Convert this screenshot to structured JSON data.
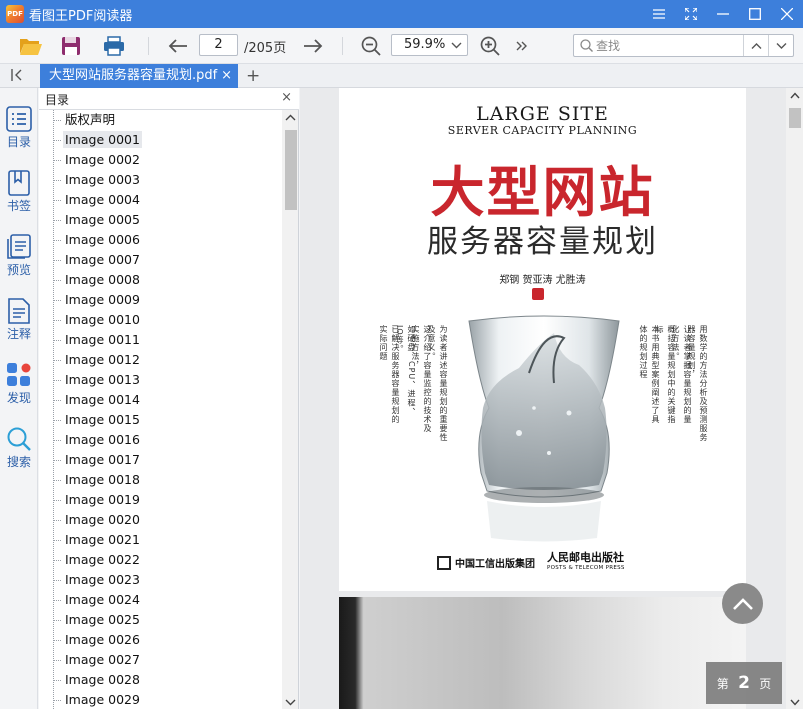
{
  "window": {
    "app_title": "看图王PDF阅读器",
    "logo_text": "PDF"
  },
  "toolbar": {
    "current_page": "2",
    "total_pages": "/205页",
    "zoom": "59.9%",
    "search_placeholder": "查找"
  },
  "tab": {
    "label": "大型网站服务器容量规划.pdf",
    "close": "×",
    "add": "+"
  },
  "rail": [
    {
      "label": "目录",
      "icon": "toc-icon"
    },
    {
      "label": "书签",
      "icon": "bookmark-icon"
    },
    {
      "label": "预览",
      "icon": "preview-icon"
    },
    {
      "label": "注释",
      "icon": "annotation-icon"
    },
    {
      "label": "发现",
      "icon": "discover-icon"
    },
    {
      "label": "搜索",
      "icon": "search-icon"
    }
  ],
  "outline": {
    "title": "目录",
    "close": "×",
    "items": [
      "版权声明",
      "Image 0001",
      "Image 0002",
      "Image 0003",
      "Image 0004",
      "Image 0005",
      "Image 0006",
      "Image 0007",
      "Image 0008",
      "Image 0009",
      "Image 0010",
      "Image 0011",
      "Image 0012",
      "Image 0013",
      "Image 0014",
      "Image 0015",
      "Image 0016",
      "Image 0017",
      "Image 0018",
      "Image 0019",
      "Image 0020",
      "Image 0021",
      "Image 0022",
      "Image 0023",
      "Image 0024",
      "Image 0025",
      "Image 0026",
      "Image 0027",
      "Image 0028",
      "Image 0029"
    ],
    "selected_index": 1
  },
  "cover": {
    "title_en_1": "LARGE SITE",
    "title_en_2": "SERVER CAPACITY PLANNING",
    "title_zh_1": "大型网站",
    "title_zh_2": "服务器容量规划",
    "authors": "郑钢  贺亚涛  尤胜涛",
    "vertical_left": [
      "已解决服务器容量规划的实际问题",
      "如硬盘、CPU、进程、IO等。",
      "这介绍了容量监控的技术及实施方法，",
      "为读者讲述容量规划的重要性及意义。"
    ],
    "vertical_right": [
      "用数学的方法分析及预测服务器容量规划，",
      "让读者掌握容量规划的量化方法。",
      "概括容量规划中的关键指标",
      "本书用典型案例阐述了具体的规划过程"
    ],
    "publisher_left": "中国工信出版集团",
    "publisher_right_zh": "人民邮电出版社",
    "publisher_right_en": "POSTS & TELECOM PRESS"
  },
  "page_indicator": {
    "prefix": "第",
    "number": "2",
    "suffix": "页"
  },
  "colors": {
    "accent": "#3d7fdb",
    "cover_red": "#c9262d"
  }
}
